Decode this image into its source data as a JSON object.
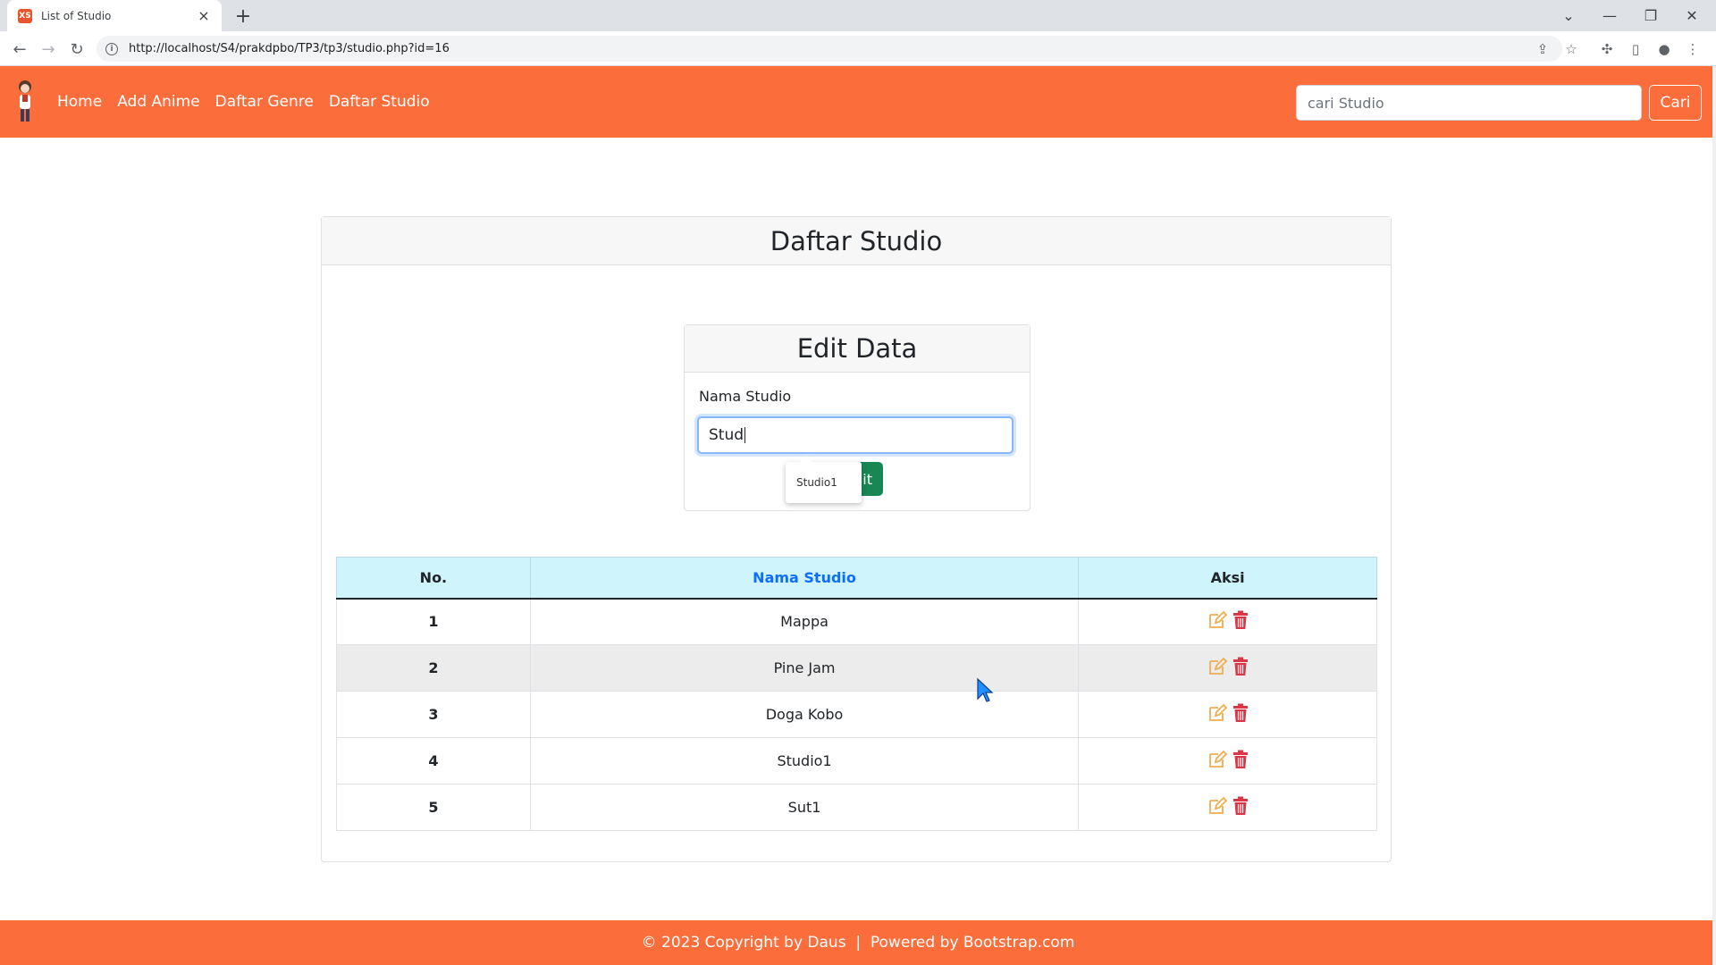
{
  "browser": {
    "tab_title": "List of Studio",
    "tab_close": "×",
    "new_tab": "+",
    "url": "http://localhost/S4/prakdpbo/TP3/tp3/studio.php?id=16",
    "favicon_text": "XS"
  },
  "navbar": {
    "links": [
      "Home",
      "Add Anime",
      "Daftar Genre",
      "Daftar Studio"
    ],
    "search_placeholder": "cari Studio",
    "search_button": "Cari",
    "bg_color": "#fb6d3a"
  },
  "main": {
    "title": "Daftar Studio",
    "edit_form": {
      "title": "Edit Data",
      "label": "Nama Studio",
      "value": "Stud",
      "submit_partial": "it",
      "autocomplete_option": "Studio1"
    },
    "table": {
      "headers": [
        "No.",
        "Nama Studio",
        "Aksi"
      ],
      "rows": [
        {
          "no": "1",
          "name": "Mappa"
        },
        {
          "no": "2",
          "name": "Pine Jam"
        },
        {
          "no": "3",
          "name": "Doga Kobo"
        },
        {
          "no": "4",
          "name": "Studio1"
        },
        {
          "no": "5",
          "name": "Sut1"
        }
      ]
    }
  },
  "footer": {
    "text": "© 2023 Copyright by Daus  |  Powered by Bootstrap.com"
  },
  "icons": {
    "edit": "edit-icon",
    "delete": "trash-icon"
  }
}
